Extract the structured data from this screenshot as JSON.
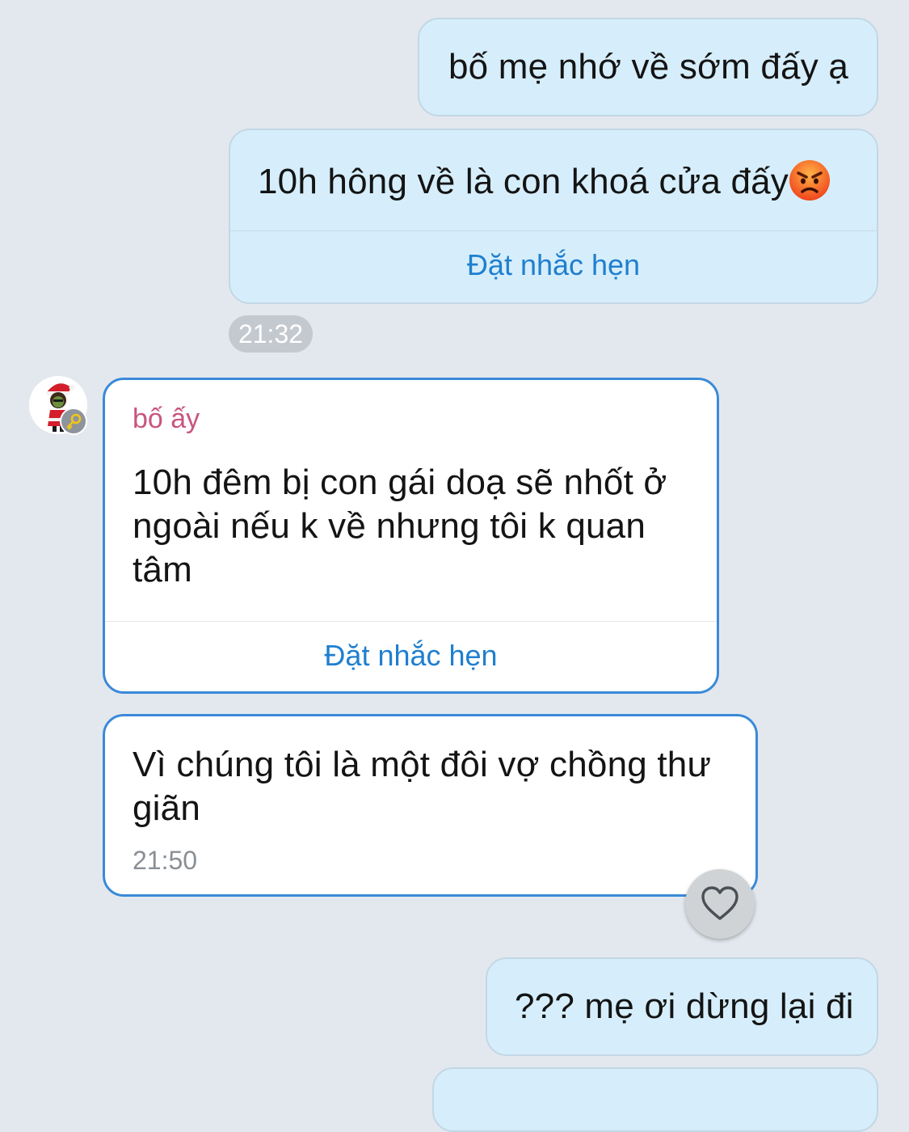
{
  "messages": [
    {
      "direction": "out",
      "text": "bố mẹ nhớ về sớm đấy ạ"
    },
    {
      "direction": "out",
      "text": "10h hông về là con khoá cửa đấy",
      "emoji": "😡",
      "action": "Đặt nhắc hẹn"
    },
    {
      "direction": "in",
      "sender": "bố ấy",
      "text": "10h đêm bị con gái doạ sẽ nhốt ở ngoài nếu k về nhưng tôi k quan tâm",
      "action": "Đặt nhắc hẹn"
    },
    {
      "direction": "in",
      "text": "Vì chúng tôi là một đôi vợ chồng thư giãn",
      "time": "21:50"
    },
    {
      "direction": "out",
      "text": "??? mẹ ơi dừng lại đi"
    }
  ],
  "time_separator": "21:32",
  "icons": {
    "avatar": "santa-avatar",
    "badge": "key-icon",
    "react": "heart-icon",
    "emoji": "angry-face-emoji"
  },
  "colors": {
    "background": "#e3e8ee",
    "outgoing_bubble": "#d6eefb",
    "incoming_border": "#3a8ad8",
    "link": "#1f7fcf",
    "sender_name": "#c8557f"
  }
}
